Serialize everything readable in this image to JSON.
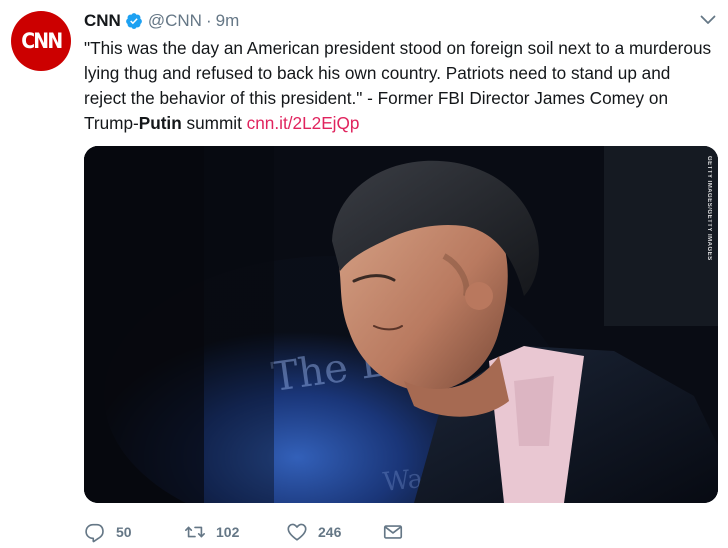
{
  "account": {
    "name": "CNN",
    "avatar_text": "CNN",
    "handle": "@CNN",
    "separator": "·",
    "time": "9m",
    "verified_icon": "verified-badge-icon"
  },
  "tweet": {
    "text_main": "\"This was the day an American president stood on foreign soil next to a murderous lying thug and refused to back his own country. Patriots need to stand up and reject the behavior of this president.\" - Former FBI Director James Comey on Trump-",
    "text_bold": "Putin",
    "text_after": " summit ",
    "link": "cnn.it/2L2EjQp"
  },
  "media": {
    "watermark": "GETTY IMAGES/GETTY IMAGES"
  },
  "actions": {
    "reply_count": "50",
    "retweet_count": "102",
    "like_count": "246"
  },
  "colors": {
    "cnn_red": "#cc0000",
    "link": "#e0245e",
    "secondary": "#657786",
    "verified": "#1da1f2"
  }
}
